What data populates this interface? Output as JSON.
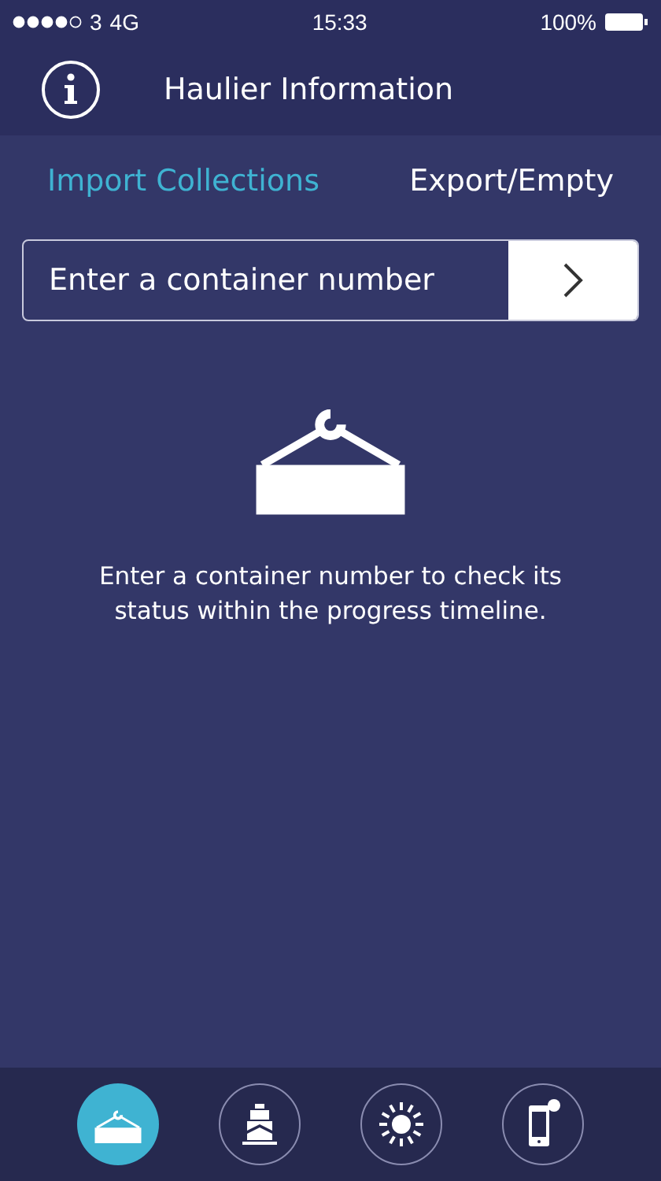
{
  "status_bar": {
    "carrier": "3",
    "network": "4G",
    "time": "15:33",
    "battery": "100%"
  },
  "header": {
    "title": "Haulier Information"
  },
  "tabs": [
    {
      "label": "Import Collections",
      "selected": true
    },
    {
      "label": "Export/Empty",
      "selected": false
    }
  ],
  "search": {
    "placeholder": "Enter a container number"
  },
  "message": "Enter a container number to check its status within the progress timeline.",
  "nav": [
    {
      "kind": "crane",
      "selected": true
    },
    {
      "kind": "ship",
      "selected": false
    },
    {
      "kind": "sun",
      "selected": false
    },
    {
      "kind": "phone",
      "selected": false
    }
  ]
}
